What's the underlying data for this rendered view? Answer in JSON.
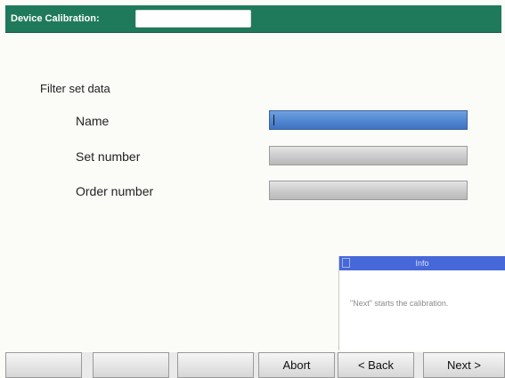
{
  "header": {
    "title": "Device Calibration:",
    "field_value": ""
  },
  "form": {
    "section_heading": "Filter set data",
    "fields": [
      {
        "label": "Name",
        "value": "",
        "active": true
      },
      {
        "label": "Set number",
        "value": "",
        "active": false
      },
      {
        "label": "Order number",
        "value": "",
        "active": false
      }
    ]
  },
  "info_box": {
    "title": "Info",
    "text": "\"Next\" starts the calibration."
  },
  "softkeys": [
    "",
    "",
    "",
    "Abort",
    "< Back",
    "Next >"
  ],
  "colors": {
    "header": "#1f7a5c",
    "active_field": "#4f84cf",
    "info_titlebar": "#4768d8"
  }
}
